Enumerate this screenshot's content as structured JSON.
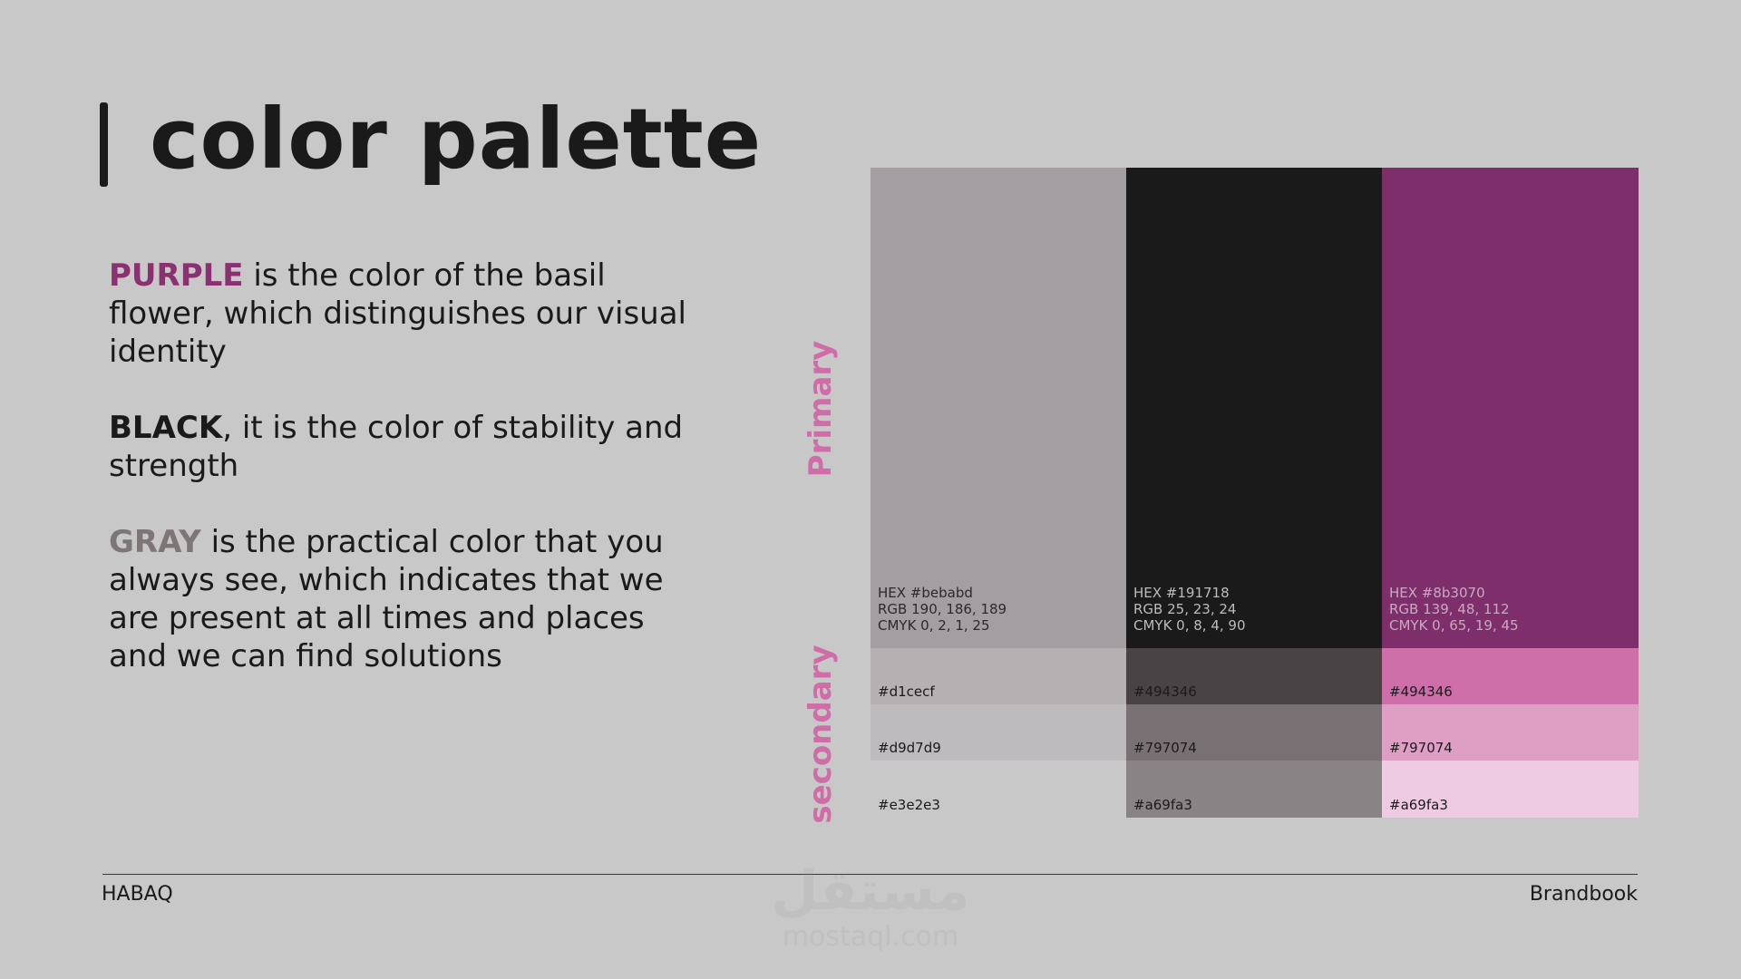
{
  "title": "color palette",
  "description": [
    {
      "keyword": "PURPLE",
      "keyword_style": "purple",
      "text": " is the color of the basil flower, which distinguishes our visual identity"
    },
    {
      "keyword": "BLACK",
      "keyword_style": "black",
      "text": ", it is the color of stability and strength"
    },
    {
      "keyword": "GRAY",
      "keyword_style": "gray",
      "text": " is the practical color that you always see, which indicates that we are present at all times and places and we can find solutions"
    }
  ],
  "labels": {
    "primary": "Primary",
    "secondary": "secondary"
  },
  "palette": [
    {
      "primary_color": "#a39ea1",
      "hex": "HEX #bebabd",
      "rgb": "RGB 190, 186, 189",
      "cmyk": "CMYK 0, 2, 1, 25",
      "info_color": "#2a2a2a",
      "secondary": [
        {
          "label": "#d1cecf",
          "color": "#b5b1b2"
        },
        {
          "label": "#d9d7d9",
          "color": "#bdbbbd"
        },
        {
          "label": "#e3e2e3",
          "color": "#c8c8c8"
        }
      ]
    },
    {
      "primary_color": "#1b1a1b",
      "hex": "HEX #191718",
      "rgb": "RGB 25, 23, 24",
      "cmyk": "CMYK 0, 8, 4, 90",
      "info_color": "#bdbbbd",
      "secondary": [
        {
          "label": "#494346",
          "color": "#494346"
        },
        {
          "label": "#797074",
          "color": "#797074"
        },
        {
          "label": "#a69fa3",
          "color": "#8a8386"
        }
      ]
    },
    {
      "primary_color": "#7e2e6a",
      "hex": "HEX #8b3070",
      "rgb": "RGB 139, 48, 112",
      "cmyk": "CMYK 0, 65, 19, 45",
      "info_color": "#c9a9c0",
      "secondary": [
        {
          "label": "#494346",
          "color": "#cf6fa9"
        },
        {
          "label": "#797074",
          "color": "#df9ec4"
        },
        {
          "label": "#a69fa3",
          "color": "#efcbe3"
        }
      ]
    }
  ],
  "footer": {
    "left": "HABAQ",
    "right": "Brandbook"
  },
  "watermark": {
    "arabic": "مستقل",
    "latin": "mostaql.com"
  }
}
